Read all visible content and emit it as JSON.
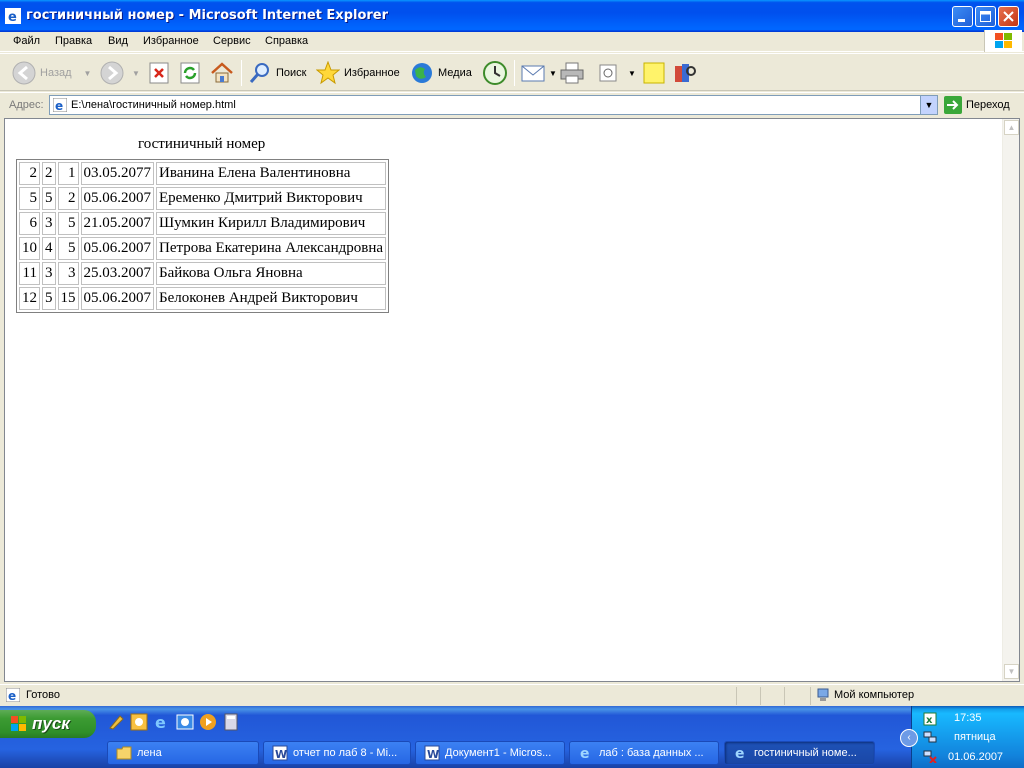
{
  "window": {
    "title": "гостиничный номер - Microsoft Internet Explorer",
    "menu": [
      "Файл",
      "Правка",
      "Вид",
      "Избранное",
      "Сервис",
      "Справка"
    ]
  },
  "toolbar": {
    "back_label": "Назад",
    "search_label": "Поиск",
    "favorites_label": "Избранное",
    "media_label": "Медиа"
  },
  "address": {
    "label": "Адрес:",
    "value": "E:\\лена\\гостиничный номер.html",
    "go_label": "Переход"
  },
  "page": {
    "caption": "гостиничный номер",
    "rows": [
      [
        "2",
        "2",
        "1",
        "03.05.2077",
        "Иванина Елена Валентиновна"
      ],
      [
        "5",
        "5",
        "2",
        "05.06.2007",
        "Еременко Дмитрий Викторович"
      ],
      [
        "6",
        "3",
        "5",
        "21.05.2007",
        "Шумкин Кирилл Владимирович"
      ],
      [
        "10",
        "4",
        "5",
        "05.06.2007",
        "Петрова Екатерина Александровна"
      ],
      [
        "11",
        "3",
        "3",
        "25.03.2007",
        "Байкова Ольга Яновна"
      ],
      [
        "12",
        "5",
        "15",
        "05.06.2007",
        "Белоконев Андрей Викторович"
      ]
    ]
  },
  "status": {
    "text": "Готово",
    "zone": "Мой компьютер"
  },
  "taskbar": {
    "start_label": "пуск",
    "tasks": [
      "лена",
      "отчет по лаб 8 - Mi...",
      "Документ1 - Micros...",
      "лаб : база данных ...",
      "гостиничный номе..."
    ],
    "clock": "17:35",
    "day": "пятница",
    "date": "01.06.2007"
  }
}
